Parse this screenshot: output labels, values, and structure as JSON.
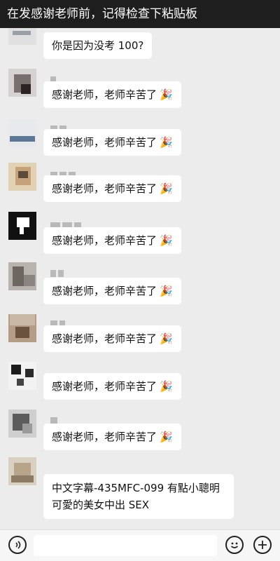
{
  "caption": "在发感谢老师前，记得检查下粘贴板",
  "messages": [
    {
      "text": "你是因为没考 100?",
      "emoji": ""
    },
    {
      "text": "感谢老师，老师辛苦了",
      "emoji": "🎉"
    },
    {
      "text": "感谢老师，老师辛苦了",
      "emoji": "🎉"
    },
    {
      "text": "感谢老师，老师辛苦了",
      "emoji": "🎉"
    },
    {
      "text": "感谢老师，老师辛苦了",
      "emoji": "🎉"
    },
    {
      "text": "感谢老师，老师辛苦了",
      "emoji": "🎉"
    },
    {
      "text": "感谢老师，老师辛苦了",
      "emoji": "🎉"
    },
    {
      "text": "感谢老师，老师辛苦了",
      "emoji": "🎉"
    },
    {
      "text": "感谢老师，老师辛苦了",
      "emoji": "🎉"
    }
  ],
  "last_message": {
    "line1": "中文字幕-435MFC-099 有點小聰明",
    "line2": "可愛的美女中出 SEX"
  },
  "footer": {
    "voice_icon": "voice-icon",
    "emoji_icon": "emoji-icon",
    "plus_icon": "plus-icon"
  }
}
